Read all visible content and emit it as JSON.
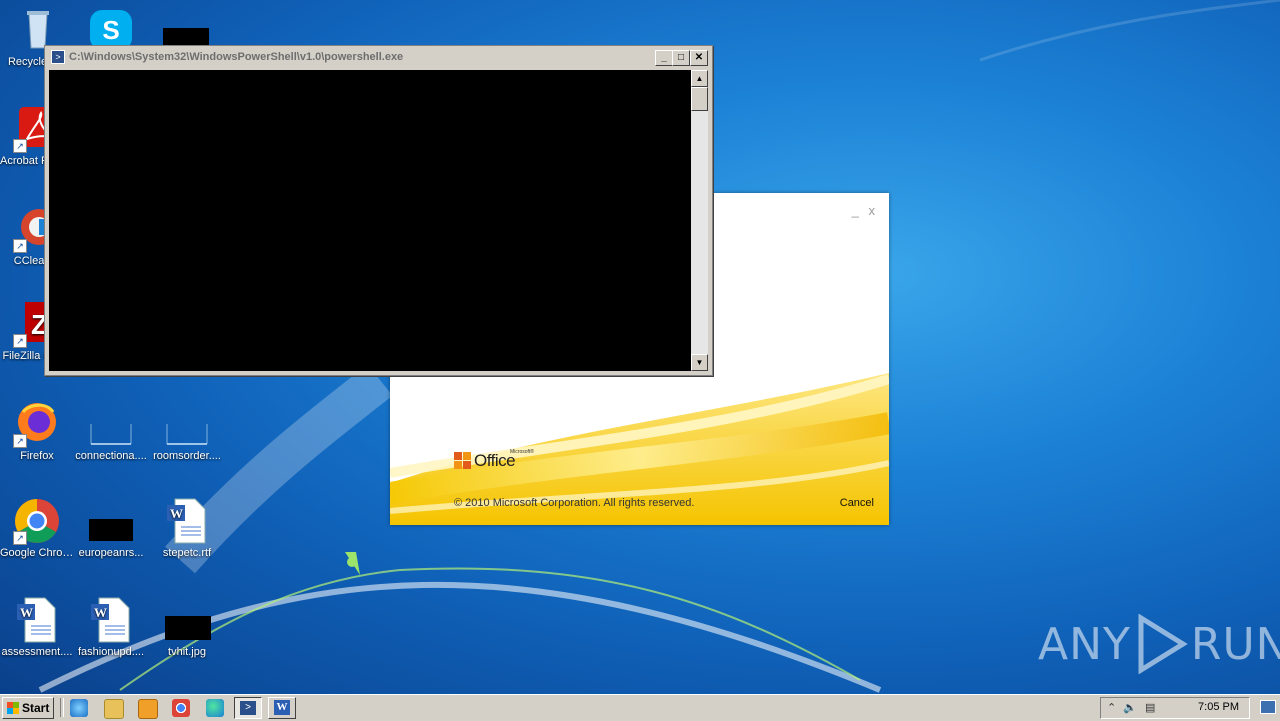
{
  "desktop": {
    "icons": [
      {
        "label": "Recycle Bin",
        "icon": "recycle-bin-icon"
      },
      {
        "label": "Acrobat Reader DC",
        "icon": "acrobat-reader-icon"
      },
      {
        "label": "CCleaner",
        "icon": "ccleaner-icon"
      },
      {
        "label": "FileZilla Client",
        "icon": "filezilla-icon"
      },
      {
        "label": "Firefox",
        "icon": "firefox-icon"
      },
      {
        "label": "connectiona....",
        "icon": "file-icon"
      },
      {
        "label": "roomsorder....",
        "icon": "file-icon"
      },
      {
        "label": "Google Chrome",
        "icon": "chrome-icon"
      },
      {
        "label": "europeanrs...",
        "icon": "image-file-icon"
      },
      {
        "label": "stepetc.rtf",
        "icon": "word-document-icon"
      },
      {
        "label": "assessment....",
        "icon": "word-document-icon"
      },
      {
        "label": "fashionupd....",
        "icon": "word-document-icon"
      },
      {
        "label": "tvhit.jpg",
        "icon": "image-file-icon"
      }
    ]
  },
  "powershell": {
    "title": "C:\\Windows\\System32\\WindowsPowerShell\\v1.0\\powershell.exe",
    "minimize": "_",
    "maximize": "□",
    "close": "✕"
  },
  "office_splash": {
    "logo_text": "Office",
    "logo_super": "Microsoft®",
    "copyright": "© 2010 Microsoft Corporation.  All rights reserved.",
    "cancel_label": "Cancel",
    "minimize": "_",
    "close": "x"
  },
  "taskbar": {
    "start_label": "Start",
    "clock": "7:05 PM"
  },
  "watermark": {
    "left": "ANY",
    "right": "RUN"
  },
  "colors": {
    "desktop_bg": "#1c82d6",
    "console_bg": "#000000",
    "office_gold": "#f5c800",
    "taskbar": "#d4d0c8"
  }
}
